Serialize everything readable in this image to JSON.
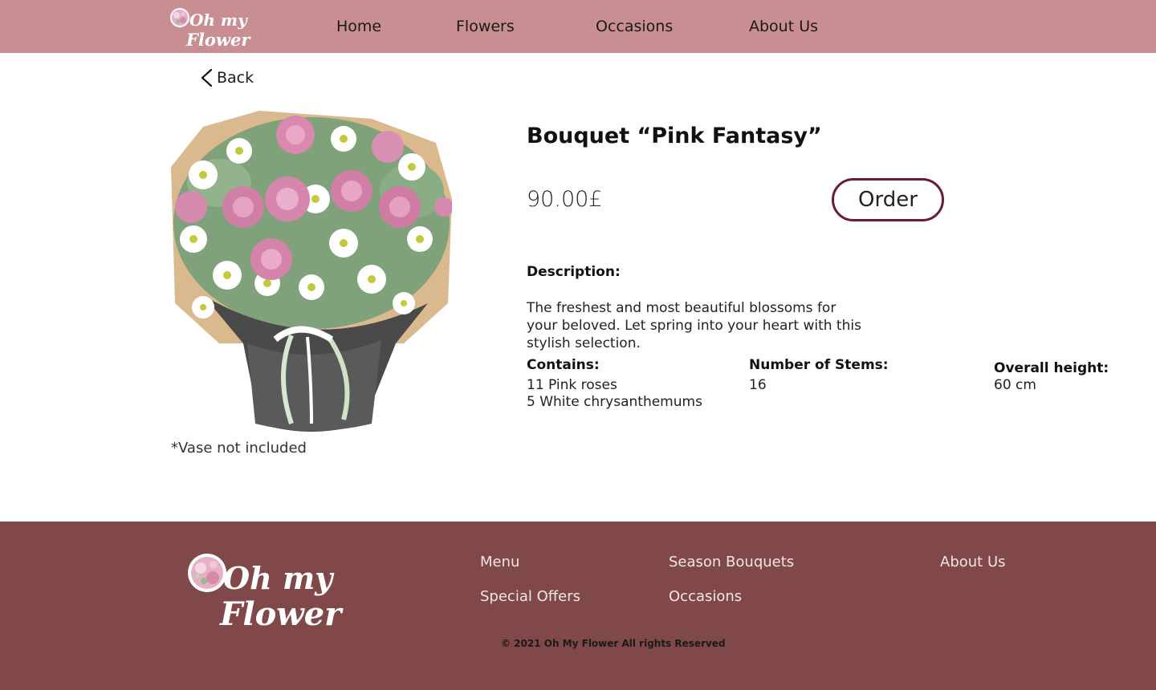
{
  "brand": {
    "logo_line1": "Oh my",
    "logo_line2": "Flower"
  },
  "nav": {
    "items": [
      {
        "label": "Home"
      },
      {
        "label": "Flowers"
      },
      {
        "label": "Occasions"
      },
      {
        "label": "About Us"
      }
    ]
  },
  "back_label": "Back",
  "product": {
    "title": "Bouquet “Pink Fantasy”",
    "price": "90.00£",
    "order_label": "Order",
    "description_label": "Description:",
    "description": "The freshest and most beautiful blossoms for your beloved. Let spring into your heart with this stylish selection.",
    "contains_label": "Contains:",
    "contains": [
      "11 Pink roses",
      "5 White chrysanthemums"
    ],
    "stems_label": "Number of Stems:",
    "stems_value": "16",
    "height_label": "Overall height:",
    "height_value": "60 cm",
    "vase_note": "*Vase not included"
  },
  "footer": {
    "links": [
      {
        "label": "Menu"
      },
      {
        "label": "Season Bouquets"
      },
      {
        "label": "About Us"
      },
      {
        "label": "Special Offers"
      },
      {
        "label": "Occasions"
      }
    ],
    "copyright": "© 2021  Oh My Flower All rights Reserved"
  },
  "colors": {
    "header_bg": "#c98e92",
    "footer_bg": "#804848",
    "order_border": "#6b1a36",
    "logo_text": "#ffffff"
  }
}
